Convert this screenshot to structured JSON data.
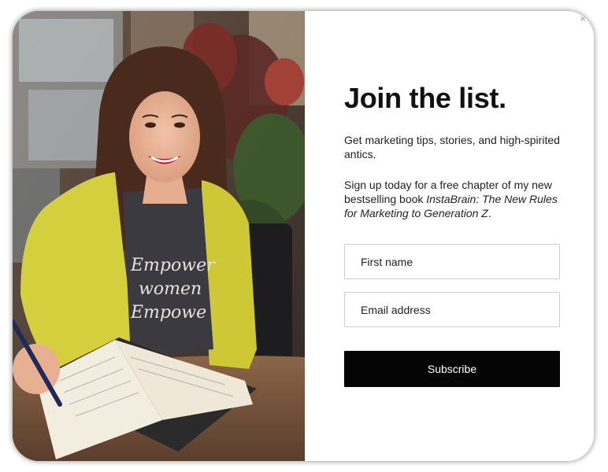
{
  "modal": {
    "close_symbol": "×",
    "headline": "Join the list.",
    "intro": "Get marketing tips, stories, and high-spirited antics.",
    "offer_prefix": "Sign up today for a free chapter of my new bestselling book ",
    "book_title": "InstaBrain: The New Rules for Marketing to Generation Z",
    "offer_suffix": ".",
    "first_name_placeholder": "First name",
    "email_placeholder": "Email address",
    "subscribe_label": "Subscribe"
  },
  "photo": {
    "shirt_text": [
      "Empower",
      "women",
      "Empowe"
    ],
    "colors": {
      "jacket": "#d4cf3c",
      "shirt": "#3b3a40",
      "hair": "#4a2a1c",
      "lips": "#c0182a"
    }
  }
}
